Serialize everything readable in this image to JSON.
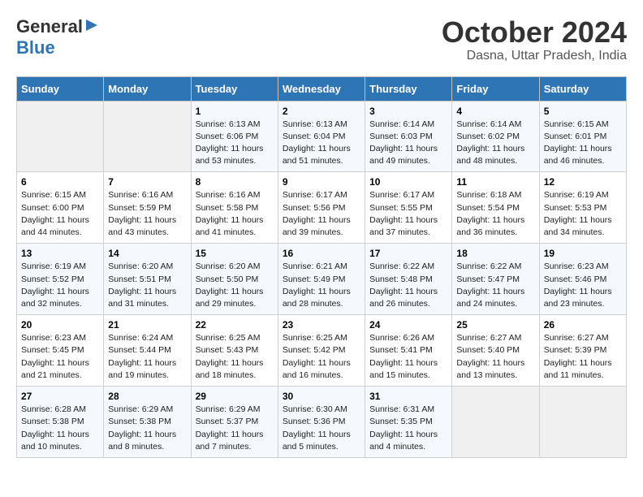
{
  "header": {
    "logo_general": "General",
    "logo_blue": "Blue",
    "month_title": "October 2024",
    "location": "Dasna, Uttar Pradesh, India"
  },
  "days_of_week": [
    "Sunday",
    "Monday",
    "Tuesday",
    "Wednesday",
    "Thursday",
    "Friday",
    "Saturday"
  ],
  "weeks": [
    [
      {
        "day": "",
        "info": ""
      },
      {
        "day": "",
        "info": ""
      },
      {
        "day": "1",
        "info": "Sunrise: 6:13 AM\nSunset: 6:06 PM\nDaylight: 11 hours\nand 53 minutes."
      },
      {
        "day": "2",
        "info": "Sunrise: 6:13 AM\nSunset: 6:04 PM\nDaylight: 11 hours\nand 51 minutes."
      },
      {
        "day": "3",
        "info": "Sunrise: 6:14 AM\nSunset: 6:03 PM\nDaylight: 11 hours\nand 49 minutes."
      },
      {
        "day": "4",
        "info": "Sunrise: 6:14 AM\nSunset: 6:02 PM\nDaylight: 11 hours\nand 48 minutes."
      },
      {
        "day": "5",
        "info": "Sunrise: 6:15 AM\nSunset: 6:01 PM\nDaylight: 11 hours\nand 46 minutes."
      }
    ],
    [
      {
        "day": "6",
        "info": "Sunrise: 6:15 AM\nSunset: 6:00 PM\nDaylight: 11 hours\nand 44 minutes."
      },
      {
        "day": "7",
        "info": "Sunrise: 6:16 AM\nSunset: 5:59 PM\nDaylight: 11 hours\nand 43 minutes."
      },
      {
        "day": "8",
        "info": "Sunrise: 6:16 AM\nSunset: 5:58 PM\nDaylight: 11 hours\nand 41 minutes."
      },
      {
        "day": "9",
        "info": "Sunrise: 6:17 AM\nSunset: 5:56 PM\nDaylight: 11 hours\nand 39 minutes."
      },
      {
        "day": "10",
        "info": "Sunrise: 6:17 AM\nSunset: 5:55 PM\nDaylight: 11 hours\nand 37 minutes."
      },
      {
        "day": "11",
        "info": "Sunrise: 6:18 AM\nSunset: 5:54 PM\nDaylight: 11 hours\nand 36 minutes."
      },
      {
        "day": "12",
        "info": "Sunrise: 6:19 AM\nSunset: 5:53 PM\nDaylight: 11 hours\nand 34 minutes."
      }
    ],
    [
      {
        "day": "13",
        "info": "Sunrise: 6:19 AM\nSunset: 5:52 PM\nDaylight: 11 hours\nand 32 minutes."
      },
      {
        "day": "14",
        "info": "Sunrise: 6:20 AM\nSunset: 5:51 PM\nDaylight: 11 hours\nand 31 minutes."
      },
      {
        "day": "15",
        "info": "Sunrise: 6:20 AM\nSunset: 5:50 PM\nDaylight: 11 hours\nand 29 minutes."
      },
      {
        "day": "16",
        "info": "Sunrise: 6:21 AM\nSunset: 5:49 PM\nDaylight: 11 hours\nand 28 minutes."
      },
      {
        "day": "17",
        "info": "Sunrise: 6:22 AM\nSunset: 5:48 PM\nDaylight: 11 hours\nand 26 minutes."
      },
      {
        "day": "18",
        "info": "Sunrise: 6:22 AM\nSunset: 5:47 PM\nDaylight: 11 hours\nand 24 minutes."
      },
      {
        "day": "19",
        "info": "Sunrise: 6:23 AM\nSunset: 5:46 PM\nDaylight: 11 hours\nand 23 minutes."
      }
    ],
    [
      {
        "day": "20",
        "info": "Sunrise: 6:23 AM\nSunset: 5:45 PM\nDaylight: 11 hours\nand 21 minutes."
      },
      {
        "day": "21",
        "info": "Sunrise: 6:24 AM\nSunset: 5:44 PM\nDaylight: 11 hours\nand 19 minutes."
      },
      {
        "day": "22",
        "info": "Sunrise: 6:25 AM\nSunset: 5:43 PM\nDaylight: 11 hours\nand 18 minutes."
      },
      {
        "day": "23",
        "info": "Sunrise: 6:25 AM\nSunset: 5:42 PM\nDaylight: 11 hours\nand 16 minutes."
      },
      {
        "day": "24",
        "info": "Sunrise: 6:26 AM\nSunset: 5:41 PM\nDaylight: 11 hours\nand 15 minutes."
      },
      {
        "day": "25",
        "info": "Sunrise: 6:27 AM\nSunset: 5:40 PM\nDaylight: 11 hours\nand 13 minutes."
      },
      {
        "day": "26",
        "info": "Sunrise: 6:27 AM\nSunset: 5:39 PM\nDaylight: 11 hours\nand 11 minutes."
      }
    ],
    [
      {
        "day": "27",
        "info": "Sunrise: 6:28 AM\nSunset: 5:38 PM\nDaylight: 11 hours\nand 10 minutes."
      },
      {
        "day": "28",
        "info": "Sunrise: 6:29 AM\nSunset: 5:38 PM\nDaylight: 11 hours\nand 8 minutes."
      },
      {
        "day": "29",
        "info": "Sunrise: 6:29 AM\nSunset: 5:37 PM\nDaylight: 11 hours\nand 7 minutes."
      },
      {
        "day": "30",
        "info": "Sunrise: 6:30 AM\nSunset: 5:36 PM\nDaylight: 11 hours\nand 5 minutes."
      },
      {
        "day": "31",
        "info": "Sunrise: 6:31 AM\nSunset: 5:35 PM\nDaylight: 11 hours\nand 4 minutes."
      },
      {
        "day": "",
        "info": ""
      },
      {
        "day": "",
        "info": ""
      }
    ]
  ]
}
